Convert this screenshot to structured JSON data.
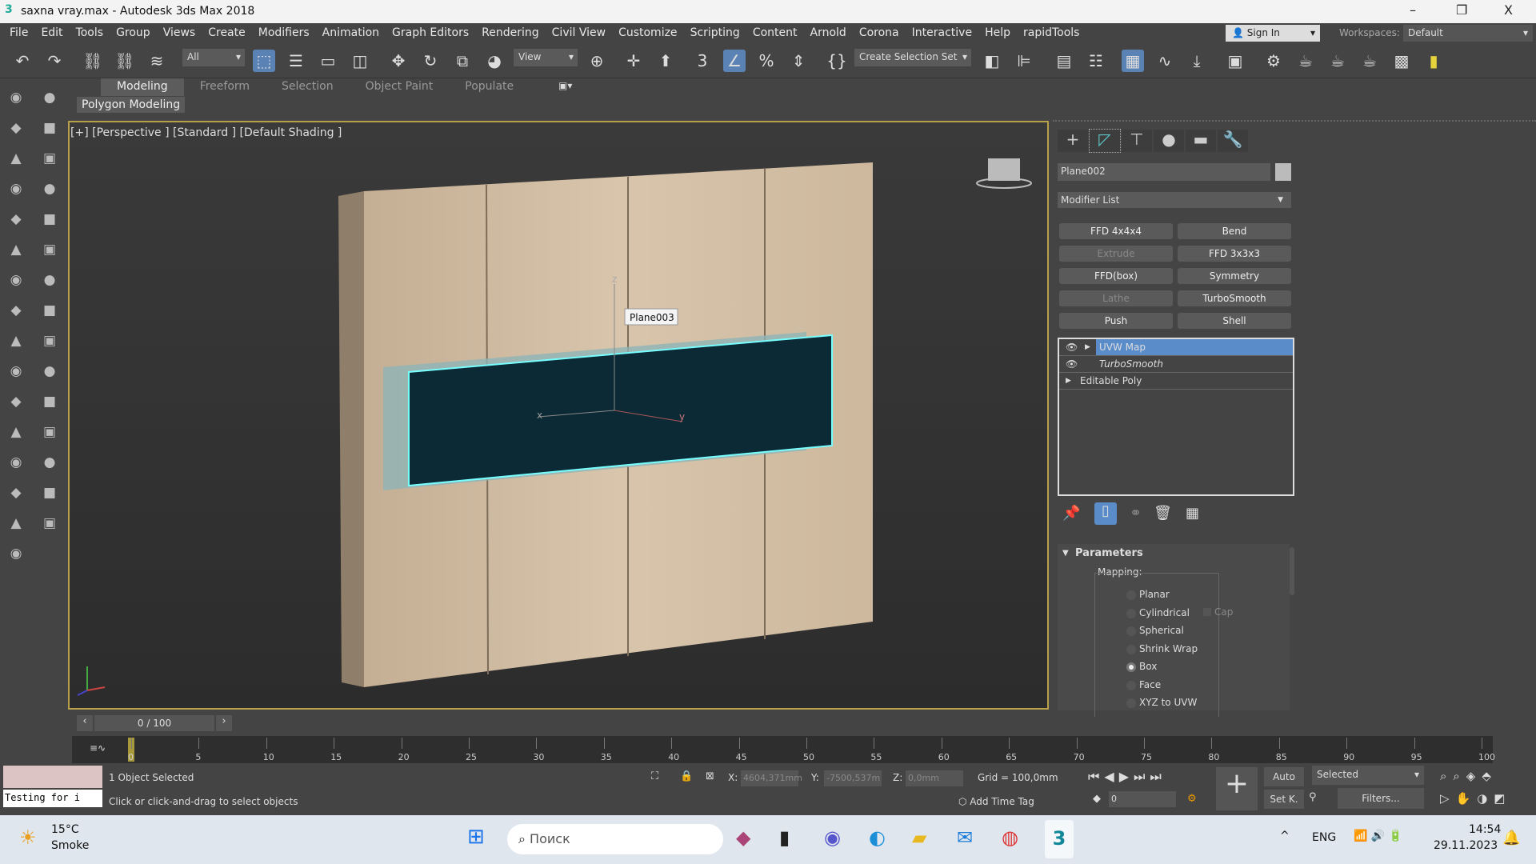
{
  "window": {
    "title": "saxna vray.max - Autodesk 3ds Max 2018",
    "minimize": "–",
    "restore": "❐",
    "close": "X"
  },
  "menu": [
    "File",
    "Edit",
    "Tools",
    "Group",
    "Views",
    "Create",
    "Modifiers",
    "Animation",
    "Graph Editors",
    "Rendering",
    "Civil View",
    "Customize",
    "Scripting",
    "Content",
    "Arnold",
    "Corona",
    "Interactive",
    "Help",
    "rapidTools"
  ],
  "account": {
    "sign_in": "Sign In",
    "workspaces_label": "Workspaces:",
    "workspace": "Default"
  },
  "toolbar": {
    "filter": "All",
    "ref_coord": "View",
    "selection_set": "Create Selection Set"
  },
  "ribbon": {
    "tabs": [
      "Modeling",
      "Freeform",
      "Selection",
      "Object Paint",
      "Populate"
    ],
    "active": "Modeling",
    "panel": "Polygon Modeling"
  },
  "viewport": {
    "label": "[+] [Perspective ] [Standard ] [Default Shading ]",
    "tooltip": "Plane003",
    "axis_x": "x",
    "axis_y": "y",
    "axis_z": "z"
  },
  "panel": {
    "object_name": "Plane002",
    "modifier_list": "Modifier List",
    "modifier_buttons": [
      {
        "label": "FFD 4x4x4",
        "enabled": true
      },
      {
        "label": "Bend",
        "enabled": true
      },
      {
        "label": "Extrude",
        "enabled": false
      },
      {
        "label": "FFD 3x3x3",
        "enabled": true
      },
      {
        "label": "FFD(box)",
        "enabled": true
      },
      {
        "label": "Symmetry",
        "enabled": true
      },
      {
        "label": "Lathe",
        "enabled": false
      },
      {
        "label": "TurboSmooth",
        "enabled": true
      },
      {
        "label": "Push",
        "enabled": true
      },
      {
        "label": "Shell",
        "enabled": true
      }
    ],
    "stack": [
      {
        "label": "UVW Map",
        "selected": true
      },
      {
        "label": "TurboSmooth",
        "selected": false
      },
      {
        "label": "Editable Poly",
        "selected": false
      }
    ],
    "rollout_title": "Parameters",
    "mapping_label": "Mapping:",
    "mapping_options": [
      "Planar",
      "Cylindrical",
      "Spherical",
      "Shrink Wrap",
      "Box",
      "Face",
      "XYZ to UVW"
    ],
    "mapping_selected": "Box",
    "cap_label": "Cap"
  },
  "timeline": {
    "frame": "0 / 100",
    "ticks": [
      "0",
      "5",
      "10",
      "15",
      "20",
      "25",
      "30",
      "35",
      "40",
      "45",
      "50",
      "55",
      "60",
      "65",
      "70",
      "75",
      "80",
      "85",
      "90",
      "95",
      "100"
    ]
  },
  "status": {
    "maxscript": "Testing for i",
    "selected": "1 Object Selected",
    "prompt": "Click or click-and-drag to select objects",
    "x_label": "X:",
    "x": "4604,371mm",
    "y_label": "Y:",
    "y": "-7500,537m",
    "z_label": "Z:",
    "z": "0,0mm",
    "grid": "Grid = 100,0mm",
    "add_time_tag": "Add Time Tag",
    "auto": "Auto",
    "set_key": "Set K.",
    "key_filter": "Selected",
    "filters": "Filters...",
    "current_frame": "0"
  },
  "taskbar": {
    "temp": "15°C",
    "weather": "Smoke",
    "search": "Поиск",
    "lang": "ENG",
    "time": "14:54",
    "date": "29.11.2023"
  }
}
